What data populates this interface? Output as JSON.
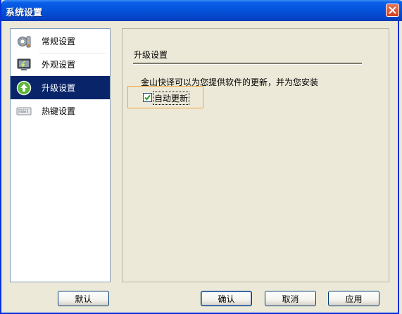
{
  "window": {
    "title": "系统设置"
  },
  "sidebar": {
    "items": [
      {
        "label": "常规设置",
        "icon": "gear-settings-icon"
      },
      {
        "label": "外观设置",
        "icon": "monitor-icon"
      },
      {
        "label": "升级设置",
        "icon": "upgrade-arrow-icon",
        "active": true
      },
      {
        "label": "热键设置",
        "icon": "keyboard-icon"
      }
    ]
  },
  "panel": {
    "section_title": "升级设置",
    "description": "金山快译可以为您提供软件的更新，并为您安装",
    "auto_update": {
      "label": "自动更新",
      "checked": true
    }
  },
  "buttons": {
    "default_label": "默认",
    "ok_label": "确认",
    "cancel_label": "取消",
    "apply_label": "应用"
  },
  "colors": {
    "titlebar": "#0453d9",
    "selected_item": "#0a246a",
    "focus_highlight": "#f3a53a",
    "window_bg": "#ece9d8"
  }
}
